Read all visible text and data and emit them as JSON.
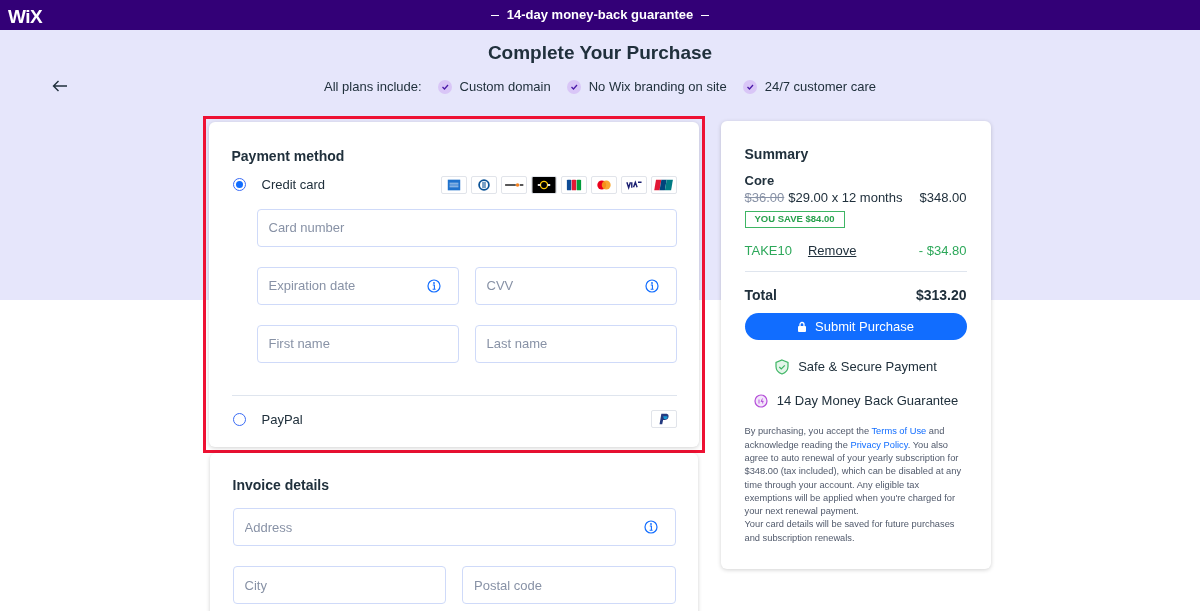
{
  "top_bar": {
    "logo": "WiX",
    "banner": "14-day money-back guarantee"
  },
  "header": {
    "title": "Complete Your Purchase",
    "includes_label": "All plans include:",
    "features": [
      "Custom domain",
      "No Wix branding on site",
      "24/7 customer care"
    ]
  },
  "payment": {
    "title": "Payment method",
    "highlighted": true,
    "options": [
      {
        "kind": "card",
        "label": "Credit card",
        "selected": true
      },
      {
        "kind": "paypal",
        "label": "PayPal",
        "selected": false
      }
    ],
    "card_brands": [
      {
        "kind": "amex"
      },
      {
        "kind": "diners"
      },
      {
        "kind": "discover"
      },
      {
        "kind": "elo"
      },
      {
        "kind": "jcb"
      },
      {
        "kind": "mastercard"
      },
      {
        "kind": "visa"
      },
      {
        "kind": "unionpay"
      }
    ],
    "field_rows": [
      [
        {
          "placeholder": "Card number",
          "info": false
        }
      ],
      [
        {
          "placeholder": "Expiration date",
          "info": true
        },
        {
          "placeholder": "CVV",
          "info": true
        }
      ],
      [
        {
          "placeholder": "First name",
          "info": false
        },
        {
          "placeholder": "Last name",
          "info": false
        }
      ]
    ]
  },
  "invoice": {
    "title": "Invoice details",
    "field_rows": [
      [
        {
          "placeholder": "Address",
          "info": true
        }
      ],
      [
        {
          "placeholder": "City",
          "info": false
        },
        {
          "placeholder": "Postal code",
          "info": false
        }
      ]
    ]
  },
  "summary": {
    "title": "Summary",
    "plan": "Core",
    "old_price": "$36.00",
    "price": "$29.00 x 12 months",
    "amount": "$348.00",
    "savings": "YOU SAVE $84.00",
    "coupon": {
      "code": "TAKE10",
      "action": "Remove",
      "discount": "- $34.80"
    },
    "total_label": "Total",
    "total": "$313.20",
    "submit": "Submit Purchase",
    "badges": [
      {
        "kind": "shield",
        "text": "Safe & Secure Payment"
      },
      {
        "kind": "refund",
        "text": "14 Day Money Back Guarantee"
      }
    ],
    "legal": [
      {
        "text": "By purchasing, you accept the ",
        "link": false
      },
      {
        "text": "Terms of Use",
        "link": true
      },
      {
        "text": " and acknowledge reading the ",
        "link": false
      },
      {
        "text": "Privacy Policy",
        "link": true
      },
      {
        "text": ". You also agree to auto renewal of your yearly subscription for $348.00 (tax included), which can be disabled at any time through your account. Any eligible tax exemptions will be applied when you're charged for your next renewal payment.",
        "link": false
      }
    ],
    "note": "Your card details will be saved for future purchases and subscription renewals."
  }
}
